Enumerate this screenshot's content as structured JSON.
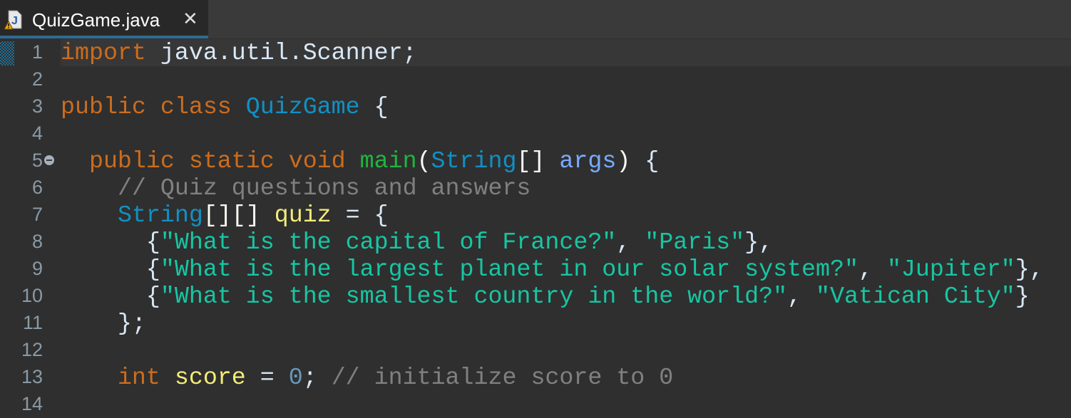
{
  "tab": {
    "title": "QuizGame.java",
    "close": "✕",
    "icon": "java-file-warning-icon"
  },
  "colors": {
    "keyword": "#cc6c1d",
    "type": "#1290c3",
    "method": "#1eb540",
    "param": "#79abff",
    "local": "#f3ec79",
    "string": "#17c6a3",
    "comment": "#808080",
    "number": "#6897bb",
    "text": "#d9e8f7",
    "punct": "#f9faf4"
  },
  "lines": [
    {
      "n": "1",
      "tokens": [
        [
          "keyword",
          "import"
        ],
        [
          "text",
          " java.util.Scanner;"
        ]
      ]
    },
    {
      "n": "2",
      "tokens": []
    },
    {
      "n": "3",
      "tokens": [
        [
          "keyword",
          "public class"
        ],
        [
          "text",
          " "
        ],
        [
          "type",
          "QuizGame"
        ],
        [
          "text",
          " {"
        ]
      ]
    },
    {
      "n": "4",
      "tokens": []
    },
    {
      "n": "5",
      "tokens": [
        [
          "text",
          "  "
        ],
        [
          "keyword",
          "public static void"
        ],
        [
          "text",
          " "
        ],
        [
          "method",
          "main"
        ],
        [
          "punct",
          "("
        ],
        [
          "type",
          "String"
        ],
        [
          "punct",
          "[]"
        ],
        [
          "text",
          " "
        ],
        [
          "param",
          "args"
        ],
        [
          "punct",
          ")"
        ],
        [
          "text",
          " {"
        ]
      ]
    },
    {
      "n": "6",
      "tokens": [
        [
          "text",
          "    "
        ],
        [
          "comment",
          "// Quiz questions and answers"
        ]
      ]
    },
    {
      "n": "7",
      "tokens": [
        [
          "text",
          "    "
        ],
        [
          "type",
          "String"
        ],
        [
          "punct",
          "[][]"
        ],
        [
          "text",
          " "
        ],
        [
          "local",
          "quiz"
        ],
        [
          "text",
          " = {"
        ]
      ]
    },
    {
      "n": "8",
      "tokens": [
        [
          "text",
          "      {"
        ],
        [
          "string",
          "\"What is the capital of France?\""
        ],
        [
          "text",
          ", "
        ],
        [
          "string",
          "\"Paris\""
        ],
        [
          "text",
          "},"
        ]
      ]
    },
    {
      "n": "9",
      "tokens": [
        [
          "text",
          "      {"
        ],
        [
          "string",
          "\"What is the largest planet in our solar system?\""
        ],
        [
          "text",
          ", "
        ],
        [
          "string",
          "\"Jupiter\""
        ],
        [
          "text",
          "},"
        ]
      ]
    },
    {
      "n": "10",
      "tokens": [
        [
          "text",
          "      {"
        ],
        [
          "string",
          "\"What is the smallest country in the world?\""
        ],
        [
          "text",
          ", "
        ],
        [
          "string",
          "\"Vatican City\""
        ],
        [
          "text",
          "}"
        ]
      ]
    },
    {
      "n": "11",
      "tokens": [
        [
          "text",
          "    };"
        ]
      ]
    },
    {
      "n": "12",
      "tokens": []
    },
    {
      "n": "13",
      "tokens": [
        [
          "text",
          "    "
        ],
        [
          "keyword",
          "int"
        ],
        [
          "text",
          " "
        ],
        [
          "local",
          "score"
        ],
        [
          "text",
          " = "
        ],
        [
          "number",
          "0"
        ],
        [
          "text",
          "; "
        ],
        [
          "comment",
          "// initialize score to 0"
        ]
      ]
    },
    {
      "n": "14",
      "tokens": []
    }
  ]
}
